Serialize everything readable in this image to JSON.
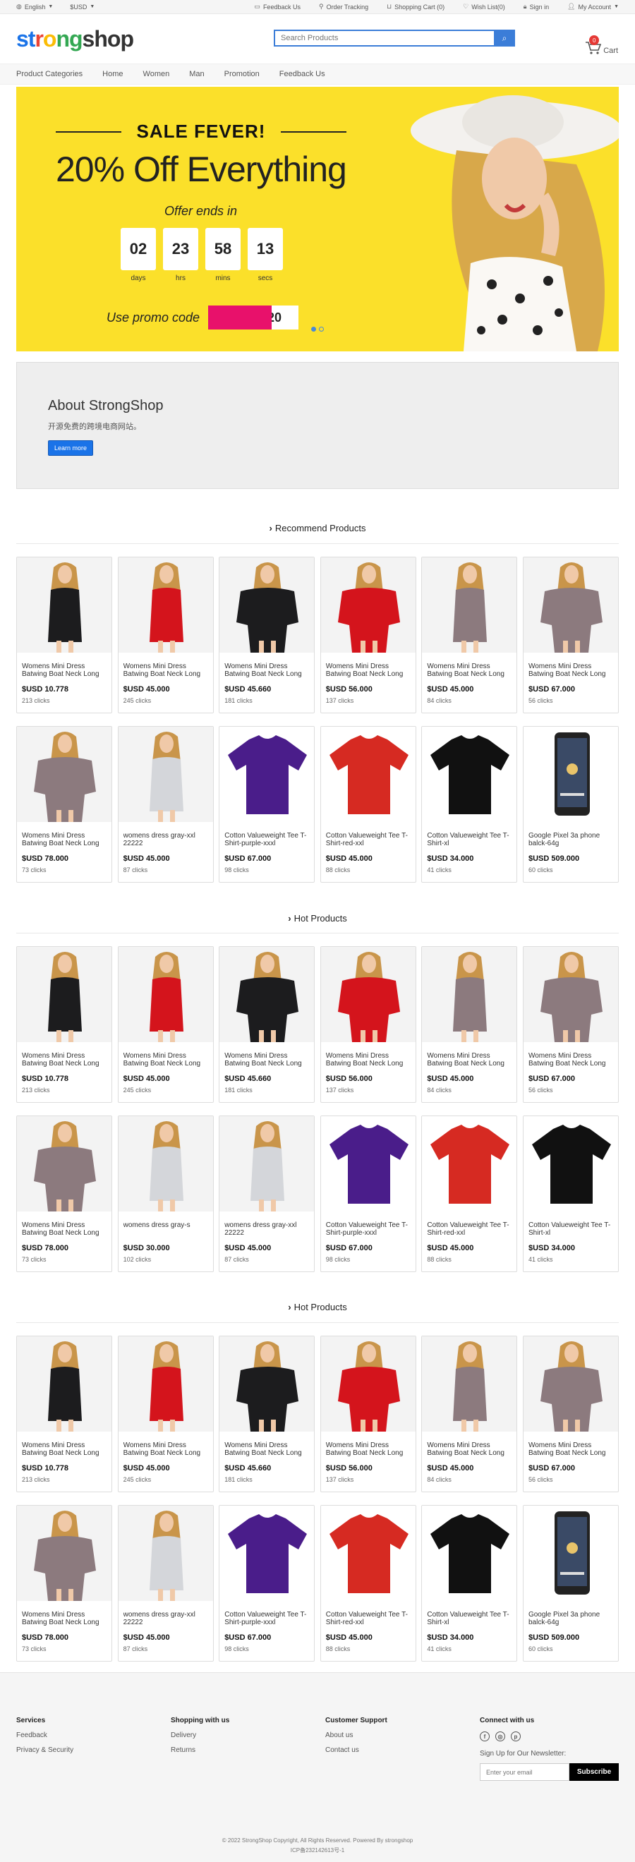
{
  "topbar": {
    "language": "English",
    "currency": "$USD",
    "links": [
      {
        "icon": "chat-icon",
        "label": "Feedback Us"
      },
      {
        "icon": "location-pin-icon",
        "label": "Order Tracking"
      },
      {
        "icon": "cart-icon",
        "label": "Shopping Cart (0)"
      },
      {
        "icon": "heart-icon",
        "label": "Wish List(0)"
      },
      {
        "icon": "lock-icon",
        "label": "Sign in"
      },
      {
        "icon": "user-icon",
        "label": "My Account"
      }
    ]
  },
  "header": {
    "logo": [
      "st",
      "r",
      "o",
      "ng",
      "shop"
    ],
    "search_placeholder": "Search Products",
    "cart_label": "Cart",
    "cart_count": "0"
  },
  "nav": [
    "Product Categories",
    "Home",
    "Women",
    "Man",
    "Promotion",
    "Feedback Us"
  ],
  "banner": {
    "headline": "SALE FEVER!",
    "offer": "20% Off Everything",
    "ends": "Offer ends in",
    "countdown": [
      {
        "value": "02",
        "label": "days"
      },
      {
        "value": "23",
        "label": "hrs"
      },
      {
        "value": "58",
        "label": "mins"
      },
      {
        "value": "13",
        "label": "secs"
      }
    ],
    "promo_label": "Use promo code",
    "promo_code": "20"
  },
  "about": {
    "title": "About StrongShop",
    "text": "开源免费的跨境电商网站。",
    "button": "Learn more"
  },
  "sections": [
    {
      "title": "Recommend Products",
      "products": [
        {
          "name": "Womens Mini Dress Batwing Boat Neck Long",
          "price": "$USD 10.778",
          "clicks": "213 clicks",
          "img": "black-dress"
        },
        {
          "name": "Womens Mini Dress Batwing Boat Neck Long",
          "price": "$USD 45.000",
          "clicks": "245 clicks",
          "img": "red-dress"
        },
        {
          "name": "Womens Mini Dress Batwing Boat Neck Long",
          "price": "$USD 45.660",
          "clicks": "181 clicks",
          "img": "black-dress-wide"
        },
        {
          "name": "Womens Mini Dress Batwing Boat Neck Long",
          "price": "$USD 56.000",
          "clicks": "137 clicks",
          "img": "red-dress-wide"
        },
        {
          "name": "Womens Mini Dress Batwing Boat Neck Long",
          "price": "$USD 45.000",
          "clicks": "84 clicks",
          "img": "mauve-dress"
        },
        {
          "name": "Womens Mini Dress Batwing Boat Neck Long",
          "price": "$USD 67.000",
          "clicks": "56 clicks",
          "img": "mauve-dress-wide"
        },
        {
          "name": "Womens Mini Dress Batwing Boat Neck Long",
          "price": "$USD 78.000",
          "clicks": "73 clicks",
          "img": "mauve-dress-back"
        },
        {
          "name": "womens dress gray-xxl 22222",
          "price": "$USD 45.000",
          "clicks": "87 clicks",
          "img": "gray-dress"
        },
        {
          "name": "Cotton Valueweight Tee T-Shirt-purple-xxxl",
          "price": "$USD 67.000",
          "clicks": "98 clicks",
          "img": "purple-tee"
        },
        {
          "name": "Cotton Valueweight Tee T-Shirt-red-xxl",
          "price": "$USD 45.000",
          "clicks": "88 clicks",
          "img": "red-tee"
        },
        {
          "name": "Cotton Valueweight Tee T-Shirt-xl",
          "price": "$USD 34.000",
          "clicks": "41 clicks",
          "img": "black-tee"
        },
        {
          "name": "Google Pixel 3a phone balck-64g",
          "price": "$USD 509.000",
          "clicks": "60 clicks",
          "img": "phone"
        }
      ]
    },
    {
      "title": "Hot Products",
      "products": [
        {
          "name": "Womens Mini Dress Batwing Boat Neck Long",
          "price": "$USD 10.778",
          "clicks": "213 clicks",
          "img": "black-dress"
        },
        {
          "name": "Womens Mini Dress Batwing Boat Neck Long",
          "price": "$USD 45.000",
          "clicks": "245 clicks",
          "img": "red-dress"
        },
        {
          "name": "Womens Mini Dress Batwing Boat Neck Long",
          "price": "$USD 45.660",
          "clicks": "181 clicks",
          "img": "black-dress-wide"
        },
        {
          "name": "Womens Mini Dress Batwing Boat Neck Long",
          "price": "$USD 56.000",
          "clicks": "137 clicks",
          "img": "red-dress-wide"
        },
        {
          "name": "Womens Mini Dress Batwing Boat Neck Long",
          "price": "$USD 45.000",
          "clicks": "84 clicks",
          "img": "mauve-dress"
        },
        {
          "name": "Womens Mini Dress Batwing Boat Neck Long",
          "price": "$USD 67.000",
          "clicks": "56 clicks",
          "img": "mauve-dress-wide"
        },
        {
          "name": "Womens Mini Dress Batwing Boat Neck Long",
          "price": "$USD 78.000",
          "clicks": "73 clicks",
          "img": "mauve-dress-back"
        },
        {
          "name": "womens dress gray-s",
          "price": "$USD 30.000",
          "clicks": "102 clicks",
          "img": "gray-dress"
        },
        {
          "name": "womens dress gray-xxl 22222",
          "price": "$USD 45.000",
          "clicks": "87 clicks",
          "img": "gray-dress"
        },
        {
          "name": "Cotton Valueweight Tee T-Shirt-purple-xxxl",
          "price": "$USD 67.000",
          "clicks": "98 clicks",
          "img": "purple-tee"
        },
        {
          "name": "Cotton Valueweight Tee T-Shirt-red-xxl",
          "price": "$USD 45.000",
          "clicks": "88 clicks",
          "img": "red-tee"
        },
        {
          "name": "Cotton Valueweight Tee T-Shirt-xl",
          "price": "$USD 34.000",
          "clicks": "41 clicks",
          "img": "black-tee"
        }
      ]
    },
    {
      "title": "Hot Products",
      "products": [
        {
          "name": "Womens Mini Dress Batwing Boat Neck Long",
          "price": "$USD 10.778",
          "clicks": "213 clicks",
          "img": "black-dress"
        },
        {
          "name": "Womens Mini Dress Batwing Boat Neck Long",
          "price": "$USD 45.000",
          "clicks": "245 clicks",
          "img": "red-dress"
        },
        {
          "name": "Womens Mini Dress Batwing Boat Neck Long",
          "price": "$USD 45.660",
          "clicks": "181 clicks",
          "img": "black-dress-wide"
        },
        {
          "name": "Womens Mini Dress Batwing Boat Neck Long",
          "price": "$USD 56.000",
          "clicks": "137 clicks",
          "img": "red-dress-wide"
        },
        {
          "name": "Womens Mini Dress Batwing Boat Neck Long",
          "price": "$USD 45.000",
          "clicks": "84 clicks",
          "img": "mauve-dress"
        },
        {
          "name": "Womens Mini Dress Batwing Boat Neck Long",
          "price": "$USD 67.000",
          "clicks": "56 clicks",
          "img": "mauve-dress-wide"
        },
        {
          "name": "Womens Mini Dress Batwing Boat Neck Long",
          "price": "$USD 78.000",
          "clicks": "73 clicks",
          "img": "mauve-dress-back"
        },
        {
          "name": "womens dress gray-xxl 22222",
          "price": "$USD 45.000",
          "clicks": "87 clicks",
          "img": "gray-dress"
        },
        {
          "name": "Cotton Valueweight Tee T-Shirt-purple-xxxl",
          "price": "$USD 67.000",
          "clicks": "98 clicks",
          "img": "purple-tee"
        },
        {
          "name": "Cotton Valueweight Tee T-Shirt-red-xxl",
          "price": "$USD 45.000",
          "clicks": "88 clicks",
          "img": "red-tee"
        },
        {
          "name": "Cotton Valueweight Tee T-Shirt-xl",
          "price": "$USD 34.000",
          "clicks": "41 clicks",
          "img": "black-tee"
        },
        {
          "name": "Google Pixel 3a phone balck-64g",
          "price": "$USD 509.000",
          "clicks": "60 clicks",
          "img": "phone"
        }
      ]
    }
  ],
  "footer": {
    "services": {
      "title": "Services",
      "links": [
        "Feedback",
        "Privacy & Security"
      ]
    },
    "shopping": {
      "title": "Shopping with us",
      "links": [
        "Delivery",
        "Returns"
      ]
    },
    "support": {
      "title": "Customer Support",
      "links": [
        "About us",
        "Contact us"
      ]
    },
    "connect": {
      "title": "Connect with us",
      "newsletter_label": "Sign Up for Our Newsletter:",
      "email_placeholder": "Enter your email",
      "subscribe": "Subscribe"
    },
    "copyright": "© 2022 StrongShop Copyright, All Rights Reserved. Powered By strongshop",
    "icp": "ICP备232142613号-1"
  },
  "colors": {
    "accent": "#1a73e8",
    "banner": "#fbe02a",
    "promo": "#e8116b"
  }
}
